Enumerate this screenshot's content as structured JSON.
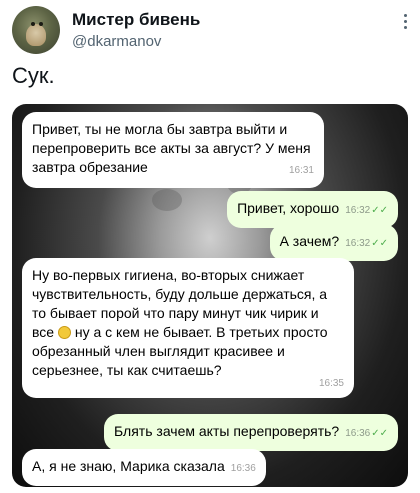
{
  "tweet": {
    "author_name": "Мистер бивень",
    "author_handle": "@dkarmanov",
    "text": "Сук."
  },
  "chat": {
    "messages": [
      {
        "direction": "in",
        "text": "Привет, ты не могла бы завтра выйти и перепроверить все акты за август? У меня завтра обрезание",
        "time": "16:31"
      },
      {
        "direction": "out",
        "text": "Привет, хорошо",
        "time": "16:32",
        "read": true
      },
      {
        "direction": "out",
        "text": "А зачем?",
        "time": "16:32",
        "read": true
      },
      {
        "direction": "in",
        "text_before_emoji": "Ну во-первых гигиена, во-вторых снижает чувствительность, буду дольше держаться, а то бывает порой что пару минут чик чирик и все",
        "emoji": "grinning-face",
        "text_after_emoji": "ну а с кем не бывает. В третьих просто обрезанный член выглядит красивее и серьезнее, ты как считаешь?",
        "time": "16:35"
      },
      {
        "direction": "out",
        "text": "Блять зачем акты перепроверять?",
        "time": "16:36",
        "read": true
      },
      {
        "direction": "in",
        "text": "А, я не знаю, Марика сказала",
        "time": "16:36"
      }
    ]
  },
  "colors": {
    "incoming_bubble": "#ffffff",
    "outgoing_bubble": "#eeffde",
    "read_checks": "#4fae4e",
    "handle_text": "#536471"
  }
}
